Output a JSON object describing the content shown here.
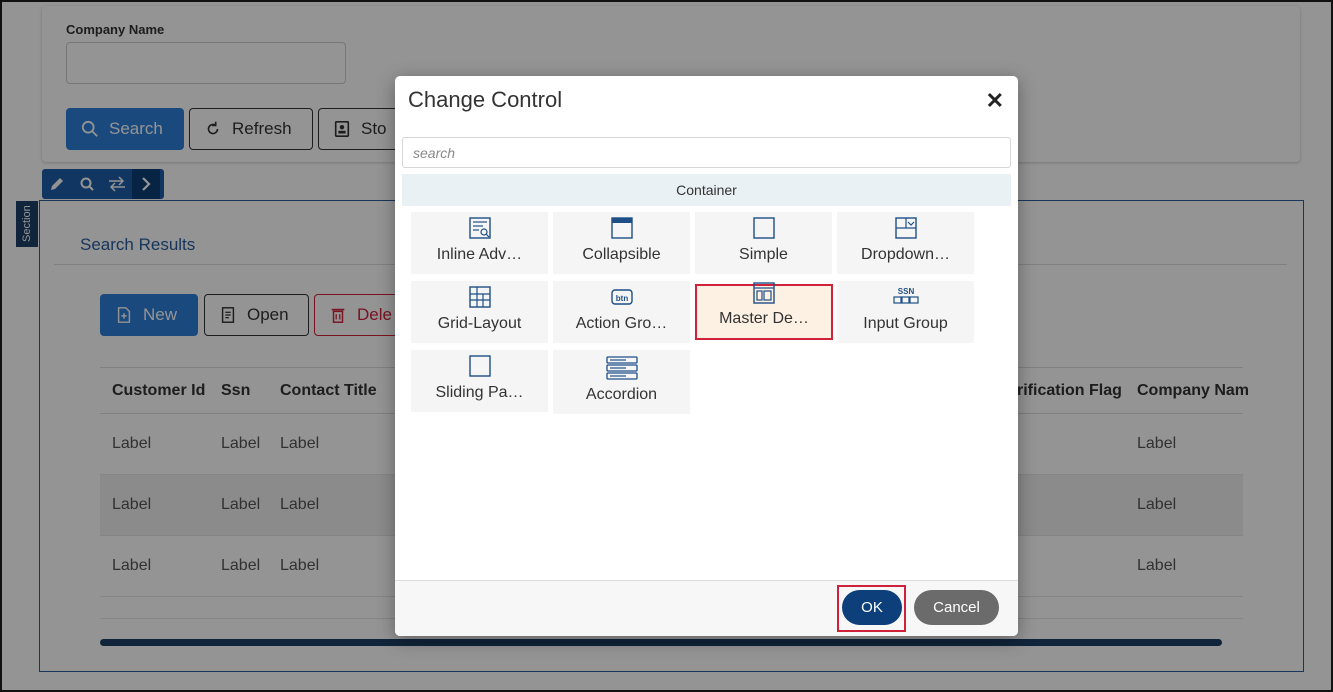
{
  "page": {
    "filter": {
      "company_name_label": "Company Name",
      "search_label": "Search",
      "refresh_label": "Refresh",
      "store_label": "Sto"
    },
    "section": {
      "tag": "Section",
      "title": "Search Results",
      "new_label": "New",
      "open_label": "Open",
      "delete_label": "Dele"
    },
    "table": {
      "headers": [
        "Customer Id",
        "Ssn",
        "Contact Title",
        "rification Flag",
        "Company Nam"
      ],
      "rows": [
        [
          "Label",
          "Label",
          "Label",
          "Label"
        ],
        [
          "Label",
          "Label",
          "Label",
          "Label"
        ],
        [
          "Label",
          "Label",
          "Label",
          "Label"
        ]
      ]
    }
  },
  "modal": {
    "title": "Change Control",
    "close_glyph": "✕",
    "search_placeholder": "search",
    "group": "Container",
    "tiles": [
      {
        "label": "Inline Adv…",
        "icon": "inline-advanced-search-icon"
      },
      {
        "label": "Collapsible",
        "icon": "collapsible-icon"
      },
      {
        "label": "Simple",
        "icon": "simple-icon"
      },
      {
        "label": "Dropdown…",
        "icon": "dropdown-icon"
      },
      {
        "label": "Grid-Layout",
        "icon": "grid-layout-icon"
      },
      {
        "label": "Action Gro…",
        "icon": "action-group-icon",
        "icon_text": "btn"
      },
      {
        "label": "Master De…",
        "icon": "master-detail-icon",
        "selected": true
      },
      {
        "label": "Input Group",
        "icon": "input-group-icon",
        "icon_text": "SSN"
      },
      {
        "label": "Sliding Pa…",
        "icon": "sliding-panel-icon"
      },
      {
        "label": "Accordion",
        "icon": "accordion-icon"
      }
    ],
    "ok_label": "OK",
    "cancel_label": "Cancel"
  },
  "colors": {
    "primary": "#2d7fd8",
    "dark_primary": "#0d3f7a",
    "danger": "#d0213a",
    "selected_bg": "#fdf1e4"
  }
}
